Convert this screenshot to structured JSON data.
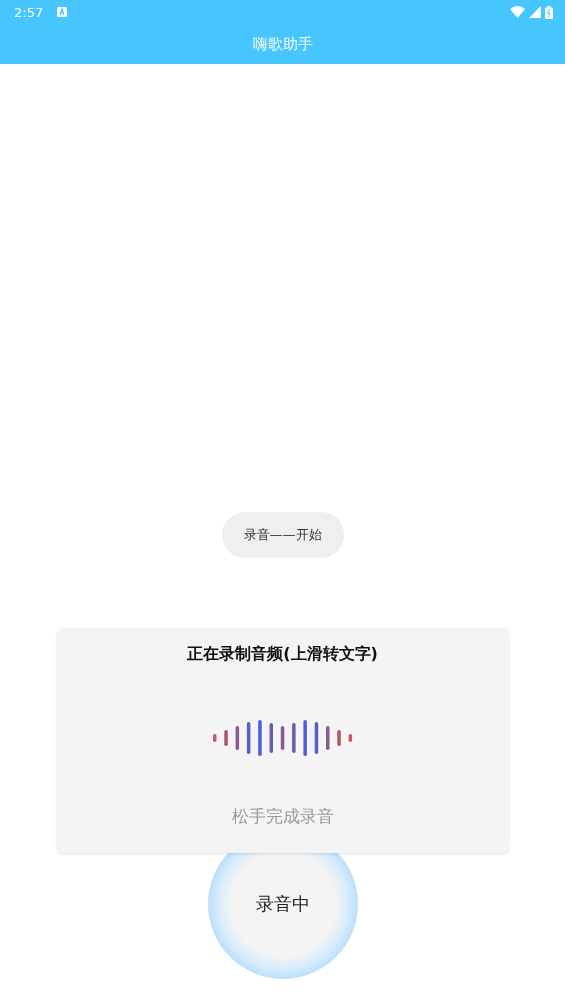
{
  "status_bar": {
    "time": "2:57"
  },
  "app_bar": {
    "title": "嗨歌助手"
  },
  "toast": {
    "text": "录音——开始"
  },
  "recording_panel": {
    "title": "正在录制音频(上滑转文字)",
    "hint": "松手完成录音"
  },
  "record_button": {
    "label": "录音中"
  }
}
